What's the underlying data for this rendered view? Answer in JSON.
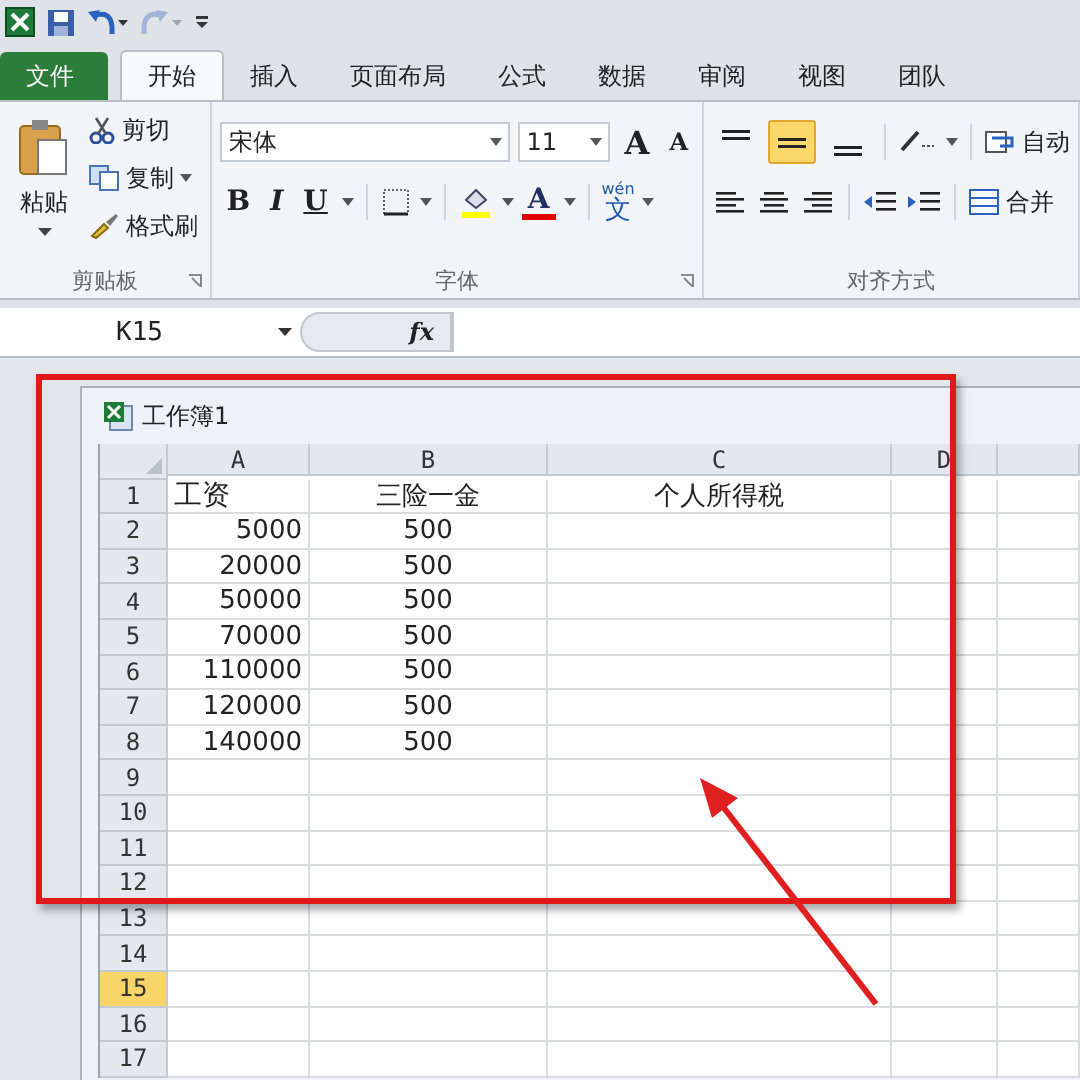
{
  "quick_access": [
    {
      "kind": "save",
      "disabled": false
    },
    {
      "kind": "undo",
      "disabled": false
    },
    {
      "kind": "redo",
      "disabled": true
    }
  ],
  "tabs": [
    {
      "label": "文件",
      "kind": "file",
      "selected": false
    },
    {
      "label": "开始",
      "kind": "tab",
      "selected": true
    },
    {
      "label": "插入",
      "kind": "tab",
      "selected": false
    },
    {
      "label": "页面布局",
      "kind": "tab",
      "selected": false
    },
    {
      "label": "公式",
      "kind": "tab",
      "selected": false
    },
    {
      "label": "数据",
      "kind": "tab",
      "selected": false
    },
    {
      "label": "审阅",
      "kind": "tab",
      "selected": false
    },
    {
      "label": "视图",
      "kind": "tab",
      "selected": false
    },
    {
      "label": "团队",
      "kind": "tab",
      "selected": false
    }
  ],
  "ribbon": {
    "clipboard": {
      "title": "剪贴板",
      "paste": "粘贴",
      "cut": "剪切",
      "copy": "复制",
      "format_painter": "格式刷"
    },
    "font": {
      "title": "字体",
      "font_name": "宋体",
      "font_size": "11",
      "grow": "A",
      "shrink": "A",
      "bold": "B",
      "italic": "I",
      "underline": "U",
      "font_color": "A",
      "phonetic_top": "wén",
      "phonetic": "文"
    },
    "alignment": {
      "title": "对齐方式",
      "vertical": [
        {
          "kind": "top",
          "selected": false
        },
        {
          "kind": "middle",
          "selected": true
        },
        {
          "kind": "bottom",
          "selected": false
        }
      ],
      "wrap_text": "自动",
      "merge": "合并"
    }
  },
  "name_box": "K15",
  "formula_bar": {
    "fx": "fx"
  },
  "workbook": {
    "title": "工作簿1",
    "columns": [
      {
        "label": "A",
        "selected": false
      },
      {
        "label": "B",
        "selected": false
      },
      {
        "label": "C",
        "selected": false
      },
      {
        "label": "D",
        "selected": false
      }
    ],
    "rows": [
      {
        "header": "1",
        "selected": false,
        "cells": [
          "工资",
          "三险一金",
          "个人所得税",
          ""
        ]
      },
      {
        "header": "2",
        "selected": false,
        "cells": [
          "5000",
          "500",
          "",
          ""
        ]
      },
      {
        "header": "3",
        "selected": false,
        "cells": [
          "20000",
          "500",
          "",
          ""
        ]
      },
      {
        "header": "4",
        "selected": false,
        "cells": [
          "50000",
          "500",
          "",
          ""
        ]
      },
      {
        "header": "5",
        "selected": false,
        "cells": [
          "70000",
          "500",
          "",
          ""
        ]
      },
      {
        "header": "6",
        "selected": false,
        "cells": [
          "110000",
          "500",
          "",
          ""
        ]
      },
      {
        "header": "7",
        "selected": false,
        "cells": [
          "120000",
          "500",
          "",
          ""
        ]
      },
      {
        "header": "8",
        "selected": false,
        "cells": [
          "140000",
          "500",
          "",
          ""
        ]
      },
      {
        "header": "9",
        "selected": false,
        "cells": [
          "",
          "",
          "",
          ""
        ]
      },
      {
        "header": "10",
        "selected": false,
        "cells": [
          "",
          "",
          "",
          ""
        ]
      },
      {
        "header": "11",
        "selected": false,
        "cells": [
          "",
          "",
          "",
          ""
        ]
      },
      {
        "header": "12",
        "selected": false,
        "cells": [
          "",
          "",
          "",
          ""
        ]
      },
      {
        "header": "13",
        "selected": false,
        "cells": [
          "",
          "",
          "",
          ""
        ]
      },
      {
        "header": "14",
        "selected": false,
        "cells": [
          "",
          "",
          "",
          ""
        ]
      },
      {
        "header": "15",
        "selected": true,
        "cells": [
          "",
          "",
          "",
          ""
        ]
      },
      {
        "header": "16",
        "selected": false,
        "cells": [
          "",
          "",
          "",
          ""
        ]
      },
      {
        "header": "17",
        "selected": false,
        "cells": [
          "",
          "",
          "",
          ""
        ]
      }
    ]
  }
}
